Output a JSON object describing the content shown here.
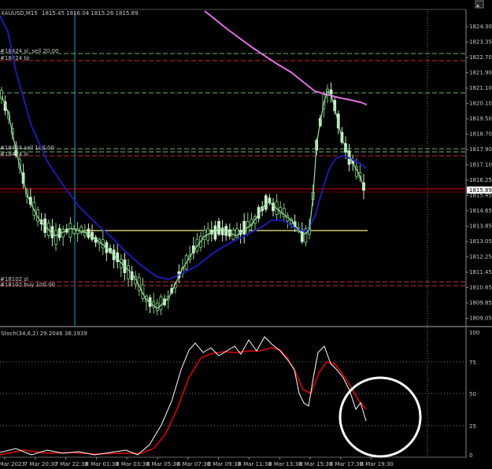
{
  "chart": {
    "symbol_header": "XAUUSD,M15",
    "ohlc_header": "1815.45 1816.04 1815.26 1815.89",
    "current_price": "1815.89",
    "price_axis_labels": [
      "1824.30",
      "1823.35",
      "1822.70",
      "1821.90",
      "1821.10",
      "1820.10",
      "1819.50",
      "1818.70",
      "1817.90",
      "1817.10",
      "1816.25",
      "1815.45",
      "1814.65",
      "1813.85",
      "1813.05",
      "1812.25",
      "1811.45",
      "1810.65",
      "1809.85",
      "1809.05"
    ],
    "time_axis_labels": [
      "7 Mar 2023",
      "7 Mar 20:30",
      "7 Mar 22:30",
      "8 Mar 01:30",
      "8 Mar 03:30",
      "8 Mar 05:30",
      "8 Mar 07:30",
      "8 Mar 09:30",
      "8 Mar 11:30",
      "8 Mar 13:30",
      "8 Mar 15:30",
      "8 Mar 17:30",
      "8 Mar 19:30"
    ],
    "order_labels": [
      {
        "text": "#18424 sl, sell 20.00",
        "color": "#e05050"
      },
      {
        "text": "#18424 tp",
        "color": "#e05050"
      },
      {
        "text": "#18424 sell 100.00",
        "color": "#e05050"
      },
      {
        "text": "#18424 sl",
        "color": "#e05050"
      },
      {
        "text": "#18102 sl",
        "color": "#e05050"
      },
      {
        "text": "#18102 buy 100.00",
        "color": "#e05050"
      }
    ]
  },
  "indicator": {
    "title": "Stoch(34,6,2) 29.2046 38.1939",
    "axis_labels": [
      "100",
      "75",
      "50",
      "25",
      "0"
    ]
  },
  "colors": {
    "background": "#000000",
    "candle_up": "#7ed07e",
    "candle_down": "#c8f0c8",
    "ma_fast": "#98e0a0",
    "ma_slow": "#1a1ab0",
    "ma_long": "#e070e0",
    "level_line": "#f0f080",
    "price_line": "#e00000",
    "stoch_main": "#ffffff",
    "stoch_signal": "#e00000",
    "circle": "#ffffff"
  }
}
